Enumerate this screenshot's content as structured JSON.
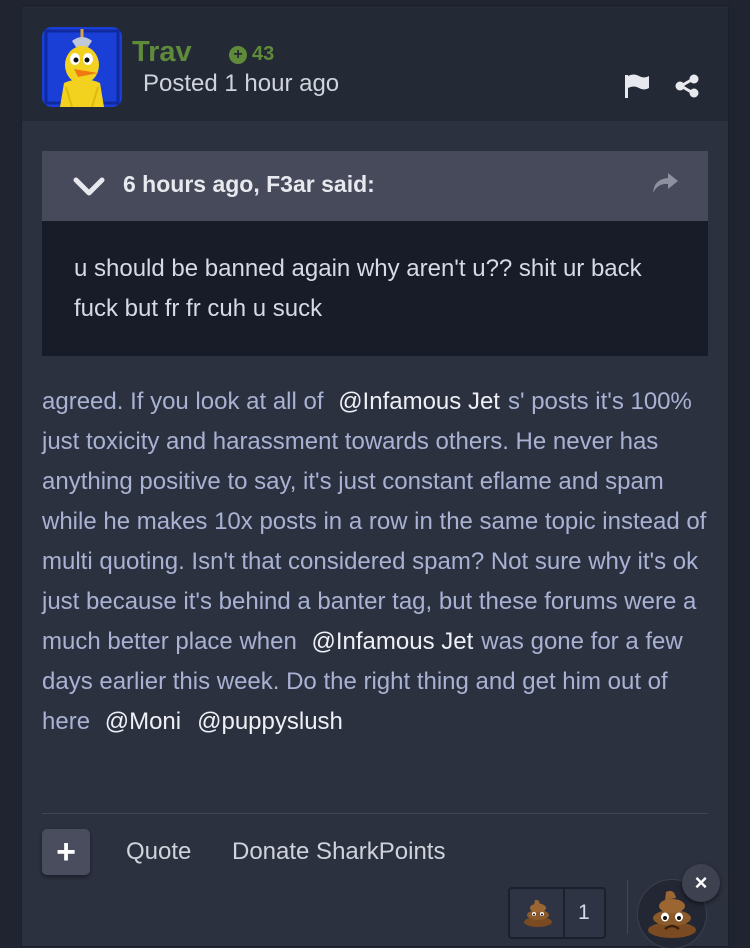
{
  "post": {
    "author": "Trav",
    "reputation": "43",
    "posted": "Posted 1 hour ago"
  },
  "quote": {
    "cite": "6 hours ago, F3ar said:",
    "text": "u should be banned again why aren't u?? shit ur back fuck but fr fr cuh u suck"
  },
  "body": {
    "t1": "agreed. If you look at all of",
    "m1": "@Infamous Jet",
    "t2": "s' posts it's 100% just toxicity and harassment towards others. He never has anything positive to say, it's just constant eflame and spam while he makes 10x posts in a row in the same topic instead of multi quoting. Isn't that considered spam? Not sure why it's ok just because it's behind a banter tag, but these forums were a much better place when",
    "m2": "@Infamous Jet",
    "t3": "was gone for a few days earlier this week. Do the right thing and get him out of here",
    "m3": "@Moni",
    "m4": "@puppyslush"
  },
  "actions": {
    "plus": "+",
    "quote": "Quote",
    "donate": "Donate SharkPoints"
  },
  "reactions": {
    "count": "1",
    "close": "×"
  },
  "icons": [
    "bird-avatar",
    "reputation-plus-icon",
    "flag-icon",
    "share-icon",
    "chevron-down-icon",
    "reply-arrow-icon",
    "poop-emoji-icon",
    "close-icon"
  ],
  "colors": {
    "author": "#5f8a3a",
    "body_text": "#a9b2d3",
    "mention": "#eef0f5"
  }
}
